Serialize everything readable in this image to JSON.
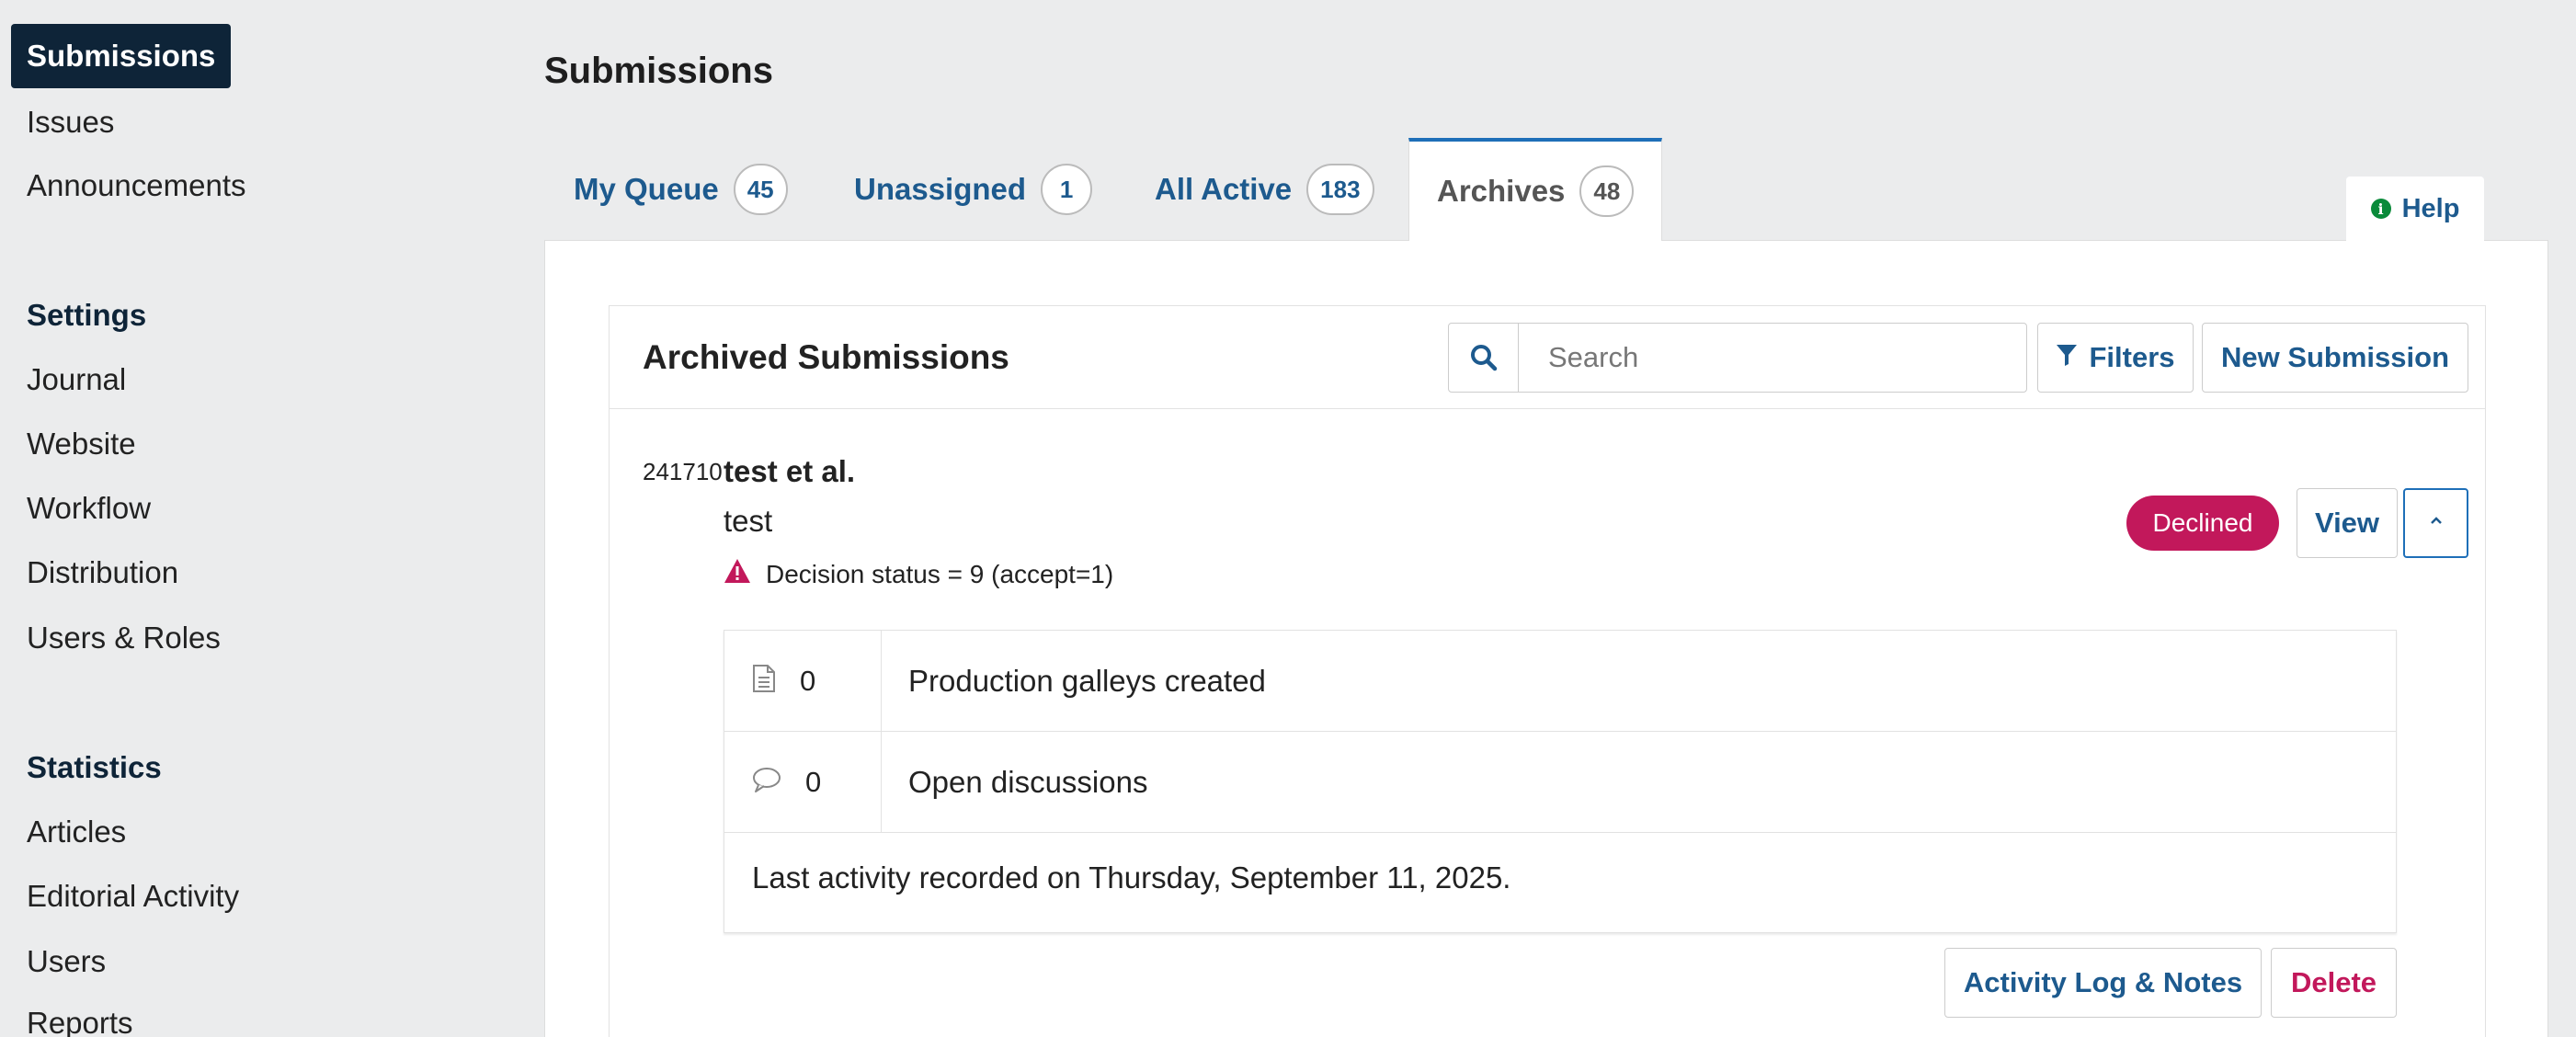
{
  "sidebar": {
    "active_item": "Submissions",
    "items": [
      "Issues",
      "Announcements"
    ],
    "settings_heading": "Settings",
    "settings_items": [
      "Journal",
      "Website",
      "Workflow",
      "Distribution",
      "Users & Roles"
    ],
    "statistics_heading": "Statistics",
    "statistics_items": [
      "Articles",
      "Editorial Activity",
      "Users",
      "Reports"
    ]
  },
  "page_title": "Submissions",
  "tabs": [
    {
      "label": "My Queue",
      "count": "45"
    },
    {
      "label": "Unassigned",
      "count": "1"
    },
    {
      "label": "All Active",
      "count": "183"
    },
    {
      "label": "Archives",
      "count": "48",
      "active": true
    }
  ],
  "help_label": "Help",
  "panel": {
    "title": "Archived Submissions",
    "search_placeholder": "Search",
    "search_value": "",
    "filters_label": "Filters",
    "new_submission_label": "New Submission"
  },
  "submission": {
    "id": "241710",
    "authors": "test et al.",
    "title": "test",
    "warning": "Decision status = 9 (accept=1)",
    "status": "Declined",
    "view_label": "View",
    "galleys_count": "0",
    "galleys_label": "Production galleys created",
    "discussions_count": "0",
    "discussions_label": "Open discussions",
    "last_activity": "Last activity recorded on Thursday, September 11, 2025.",
    "activity_log_label": "Activity Log & Notes",
    "delete_label": "Delete"
  },
  "colors": {
    "sidebar_active_bg": "#0e2438",
    "link_blue": "#1d5a8e",
    "tab_accent": "#1e6fb8",
    "declined_badge": "#c2185b",
    "help_icon": "#0a8a3a",
    "page_bg": "#ebeced"
  },
  "icons": {
    "search": "search-icon",
    "filter": "filter-icon",
    "warning": "warning-icon",
    "chevron": "chevron-up-icon",
    "galleys": "document-icon",
    "discussions": "comment-icon",
    "help": "info-icon"
  }
}
